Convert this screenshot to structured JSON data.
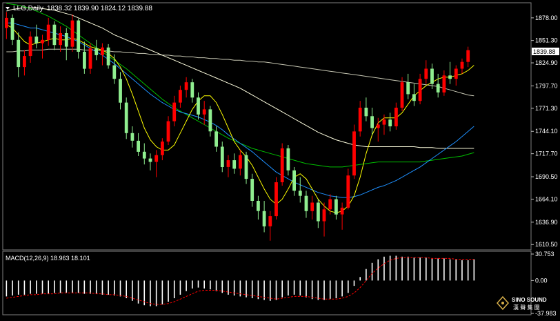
{
  "header": {
    "symbol": "LLG,Daily",
    "ohlc": "1838.32 1839.90 1824.12 1839.88"
  },
  "price_panel": {
    "ticks": [
      "1878.00",
      "1851.30",
      "1824.90",
      "1797.70",
      "1771.30",
      "1744.10",
      "1717.70",
      "1690.50",
      "1664.10",
      "1636.90",
      "1610.50"
    ],
    "current_price": "1839.88"
  },
  "macd_panel": {
    "label": "MACD(12,26,9) 18.963 18.101",
    "ticks": [
      "30.753",
      "0.00",
      "-37.983"
    ]
  },
  "watermark": {
    "brand": "SINO SOUND",
    "sub": "漢 聲 集 團"
  },
  "colors": {
    "background": "#000000",
    "bull_candle": "#ff0000",
    "bear_candle": "#90ee90",
    "ma_fast": "#ffff00",
    "ma_mid": "#1e90ff",
    "ma_slow": "#00c000",
    "ma_long": "#ffffe0",
    "ma_longest": "#c8c8b4",
    "macd_hist": "#ffffff",
    "macd_signal": "#ff0000"
  },
  "chart_data": {
    "type": "candlestick",
    "ylim": [
      1605,
      1895
    ],
    "candles": [
      {
        "o": 1866,
        "h": 1885,
        "l": 1853,
        "c": 1878
      },
      {
        "o": 1878,
        "h": 1882,
        "l": 1846,
        "c": 1852
      },
      {
        "o": 1852,
        "h": 1861,
        "l": 1808,
        "c": 1820
      },
      {
        "o": 1820,
        "h": 1840,
        "l": 1810,
        "c": 1833
      },
      {
        "o": 1833,
        "h": 1862,
        "l": 1825,
        "c": 1856
      },
      {
        "o": 1856,
        "h": 1870,
        "l": 1842,
        "c": 1848
      },
      {
        "o": 1848,
        "h": 1858,
        "l": 1830,
        "c": 1852
      },
      {
        "o": 1852,
        "h": 1878,
        "l": 1845,
        "c": 1870
      },
      {
        "o": 1870,
        "h": 1874,
        "l": 1840,
        "c": 1846
      },
      {
        "o": 1846,
        "h": 1868,
        "l": 1838,
        "c": 1860
      },
      {
        "o": 1860,
        "h": 1866,
        "l": 1828,
        "c": 1844
      },
      {
        "o": 1844,
        "h": 1882,
        "l": 1838,
        "c": 1875
      },
      {
        "o": 1875,
        "h": 1877,
        "l": 1830,
        "c": 1838
      },
      {
        "o": 1838,
        "h": 1850,
        "l": 1812,
        "c": 1818
      },
      {
        "o": 1818,
        "h": 1848,
        "l": 1812,
        "c": 1842
      },
      {
        "o": 1842,
        "h": 1852,
        "l": 1828,
        "c": 1834
      },
      {
        "o": 1834,
        "h": 1848,
        "l": 1822,
        "c": 1843
      },
      {
        "o": 1843,
        "h": 1847,
        "l": 1818,
        "c": 1822
      },
      {
        "o": 1822,
        "h": 1835,
        "l": 1800,
        "c": 1806
      },
      {
        "o": 1806,
        "h": 1814,
        "l": 1770,
        "c": 1778
      },
      {
        "o": 1778,
        "h": 1784,
        "l": 1735,
        "c": 1742
      },
      {
        "o": 1742,
        "h": 1750,
        "l": 1725,
        "c": 1733
      },
      {
        "o": 1733,
        "h": 1742,
        "l": 1715,
        "c": 1720
      },
      {
        "o": 1720,
        "h": 1730,
        "l": 1705,
        "c": 1712
      },
      {
        "o": 1712,
        "h": 1718,
        "l": 1698,
        "c": 1708
      },
      {
        "o": 1708,
        "h": 1722,
        "l": 1690,
        "c": 1716
      },
      {
        "o": 1716,
        "h": 1736,
        "l": 1710,
        "c": 1732
      },
      {
        "o": 1732,
        "h": 1762,
        "l": 1728,
        "c": 1756
      },
      {
        "o": 1756,
        "h": 1786,
        "l": 1750,
        "c": 1778
      },
      {
        "o": 1778,
        "h": 1798,
        "l": 1772,
        "c": 1793
      },
      {
        "o": 1793,
        "h": 1808,
        "l": 1784,
        "c": 1802
      },
      {
        "o": 1802,
        "h": 1806,
        "l": 1778,
        "c": 1784
      },
      {
        "o": 1784,
        "h": 1790,
        "l": 1758,
        "c": 1764
      },
      {
        "o": 1764,
        "h": 1780,
        "l": 1752,
        "c": 1770
      },
      {
        "o": 1770,
        "h": 1774,
        "l": 1738,
        "c": 1744
      },
      {
        "o": 1744,
        "h": 1750,
        "l": 1720,
        "c": 1726
      },
      {
        "o": 1726,
        "h": 1732,
        "l": 1696,
        "c": 1702
      },
      {
        "o": 1702,
        "h": 1716,
        "l": 1690,
        "c": 1710
      },
      {
        "o": 1710,
        "h": 1718,
        "l": 1694,
        "c": 1700
      },
      {
        "o": 1700,
        "h": 1722,
        "l": 1692,
        "c": 1716
      },
      {
        "o": 1716,
        "h": 1720,
        "l": 1682,
        "c": 1688
      },
      {
        "o": 1688,
        "h": 1694,
        "l": 1655,
        "c": 1662
      },
      {
        "o": 1662,
        "h": 1668,
        "l": 1640,
        "c": 1650
      },
      {
        "o": 1650,
        "h": 1662,
        "l": 1625,
        "c": 1632
      },
      {
        "o": 1632,
        "h": 1650,
        "l": 1615,
        "c": 1644
      },
      {
        "o": 1644,
        "h": 1690,
        "l": 1640,
        "c": 1684
      },
      {
        "o": 1684,
        "h": 1730,
        "l": 1680,
        "c": 1724
      },
      {
        "o": 1724,
        "h": 1728,
        "l": 1692,
        "c": 1698
      },
      {
        "o": 1698,
        "h": 1702,
        "l": 1668,
        "c": 1674
      },
      {
        "o": 1674,
        "h": 1690,
        "l": 1660,
        "c": 1668
      },
      {
        "o": 1668,
        "h": 1674,
        "l": 1642,
        "c": 1650
      },
      {
        "o": 1650,
        "h": 1668,
        "l": 1640,
        "c": 1660
      },
      {
        "o": 1660,
        "h": 1664,
        "l": 1630,
        "c": 1638
      },
      {
        "o": 1638,
        "h": 1660,
        "l": 1620,
        "c": 1652
      },
      {
        "o": 1652,
        "h": 1670,
        "l": 1646,
        "c": 1664
      },
      {
        "o": 1664,
        "h": 1668,
        "l": 1640,
        "c": 1646
      },
      {
        "o": 1646,
        "h": 1660,
        "l": 1628,
        "c": 1654
      },
      {
        "o": 1654,
        "h": 1700,
        "l": 1652,
        "c": 1692
      },
      {
        "o": 1692,
        "h": 1752,
        "l": 1688,
        "c": 1744
      },
      {
        "o": 1744,
        "h": 1780,
        "l": 1738,
        "c": 1772
      },
      {
        "o": 1772,
        "h": 1784,
        "l": 1756,
        "c": 1762
      },
      {
        "o": 1762,
        "h": 1772,
        "l": 1740,
        "c": 1748
      },
      {
        "o": 1748,
        "h": 1760,
        "l": 1732,
        "c": 1752
      },
      {
        "o": 1752,
        "h": 1764,
        "l": 1740,
        "c": 1758
      },
      {
        "o": 1758,
        "h": 1766,
        "l": 1744,
        "c": 1750
      },
      {
        "o": 1750,
        "h": 1778,
        "l": 1746,
        "c": 1772
      },
      {
        "o": 1772,
        "h": 1808,
        "l": 1768,
        "c": 1802
      },
      {
        "o": 1802,
        "h": 1812,
        "l": 1782,
        "c": 1788
      },
      {
        "o": 1788,
        "h": 1800,
        "l": 1774,
        "c": 1780
      },
      {
        "o": 1780,
        "h": 1812,
        "l": 1776,
        "c": 1806
      },
      {
        "o": 1806,
        "h": 1828,
        "l": 1800,
        "c": 1818
      },
      {
        "o": 1818,
        "h": 1824,
        "l": 1794,
        "c": 1800
      },
      {
        "o": 1800,
        "h": 1812,
        "l": 1784,
        "c": 1790
      },
      {
        "o": 1790,
        "h": 1816,
        "l": 1786,
        "c": 1810
      },
      {
        "o": 1810,
        "h": 1826,
        "l": 1800,
        "c": 1806
      },
      {
        "o": 1806,
        "h": 1822,
        "l": 1798,
        "c": 1818
      },
      {
        "o": 1818,
        "h": 1830,
        "l": 1812,
        "c": 1826
      },
      {
        "o": 1826,
        "h": 1844,
        "l": 1820,
        "c": 1839.88
      }
    ],
    "ma_fast": [
      1870,
      1866,
      1858,
      1850,
      1846,
      1848,
      1850,
      1852,
      1854,
      1852,
      1852,
      1854,
      1852,
      1848,
      1844,
      1842,
      1840,
      1836,
      1830,
      1820,
      1806,
      1788,
      1768,
      1748,
      1734,
      1726,
      1722,
      1722,
      1728,
      1742,
      1756,
      1770,
      1780,
      1786,
      1786,
      1778,
      1764,
      1748,
      1732,
      1722,
      1714,
      1704,
      1690,
      1676,
      1664,
      1658,
      1664,
      1676,
      1690,
      1694,
      1688,
      1676,
      1664,
      1656,
      1650,
      1648,
      1650,
      1656,
      1668,
      1690,
      1718,
      1740,
      1754,
      1760,
      1760,
      1760,
      1766,
      1776,
      1786,
      1792,
      1798,
      1802,
      1806,
      1808,
      1808,
      1810,
      1812,
      1816,
      1822
    ],
    "ma_mid": [
      1872,
      1872,
      1870,
      1868,
      1866,
      1866,
      1864,
      1862,
      1860,
      1858,
      1856,
      1853,
      1850,
      1846,
      1842,
      1838,
      1834,
      1829,
      1824,
      1818,
      1812,
      1806,
      1800,
      1794,
      1788,
      1783,
      1778,
      1774,
      1770,
      1767,
      1765,
      1763,
      1761,
      1758,
      1755,
      1751,
      1746,
      1740,
      1735,
      1730,
      1725,
      1720,
      1714,
      1708,
      1702,
      1696,
      1692,
      1688,
      1684,
      1681,
      1678,
      1675,
      1672,
      1670,
      1668,
      1667,
      1666,
      1666,
      1667,
      1669,
      1672,
      1675,
      1678,
      1680,
      1683,
      1686,
      1690,
      1694,
      1698,
      1702,
      1707,
      1712,
      1717,
      1722,
      1727,
      1732,
      1738,
      1744,
      1750
    ],
    "ma_slow": [
      1895,
      1894,
      1893,
      1891,
      1889,
      1886,
      1883,
      1880,
      1876,
      1872,
      1868,
      1863,
      1858,
      1853,
      1848,
      1843,
      1838,
      1833,
      1828,
      1823,
      1818,
      1812,
      1806,
      1800,
      1794,
      1788,
      1782,
      1777,
      1772,
      1768,
      1764,
      1760,
      1756,
      1752,
      1748,
      1744,
      1740,
      1736,
      1733,
      1730,
      1727,
      1724,
      1722,
      1720,
      1718,
      1716,
      1714,
      1712,
      1710,
      1708,
      1706,
      1705,
      1704,
      1703,
      1702,
      1702,
      1702,
      1703,
      1704,
      1705,
      1706,
      1707,
      1708,
      1708,
      1708,
      1708,
      1708,
      1708,
      1708,
      1708,
      1709,
      1710,
      1711,
      1712,
      1713,
      1714,
      1715,
      1717,
      1719
    ],
    "ma_long": [
      1886,
      1888,
      1889,
      1890,
      1890,
      1890,
      1889,
      1888,
      1887,
      1885,
      1883,
      1881,
      1878,
      1875,
      1872,
      1869,
      1866,
      1862,
      1858,
      1855,
      1852,
      1849,
      1846,
      1843,
      1840,
      1837,
      1834,
      1831,
      1828,
      1825,
      1822,
      1819,
      1816,
      1813,
      1810,
      1807,
      1804,
      1801,
      1798,
      1795,
      1791,
      1787,
      1783,
      1779,
      1775,
      1771,
      1767,
      1763,
      1759,
      1755,
      1751,
      1747,
      1743,
      1740,
      1737,
      1734,
      1732,
      1730,
      1728,
      1727,
      1726,
      1726,
      1726,
      1726,
      1726,
      1726,
      1726,
      1726,
      1726,
      1725,
      1725,
      1725,
      1724,
      1724,
      1724,
      1724,
      1724,
      1724,
      1724
    ],
    "ma_longest": [
      1838,
      1838,
      1839,
      1839,
      1840,
      1840,
      1840,
      1841,
      1841,
      1841,
      1841,
      1841,
      1841,
      1840,
      1840,
      1840,
      1839,
      1839,
      1838,
      1838,
      1837,
      1837,
      1836,
      1836,
      1835,
      1835,
      1834,
      1834,
      1833,
      1833,
      1832,
      1832,
      1831,
      1831,
      1830,
      1830,
      1829,
      1829,
      1828,
      1828,
      1827,
      1827,
      1826,
      1826,
      1825,
      1824,
      1823,
      1822,
      1821,
      1820,
      1819,
      1818,
      1817,
      1816,
      1815,
      1814,
      1813,
      1812,
      1811,
      1810,
      1809,
      1808,
      1807,
      1806,
      1805,
      1804,
      1803,
      1802,
      1801,
      1800,
      1799,
      1798,
      1797,
      1795,
      1793,
      1791,
      1789,
      1787,
      1786
    ],
    "macd": {
      "ylim": [
        -37.983,
        30.753
      ],
      "histogram": [
        -18,
        -17,
        -16,
        -16,
        -15,
        -15,
        -15,
        -15,
        -14,
        -14,
        -14,
        -14,
        -14,
        -15,
        -15,
        -15,
        -16,
        -16,
        -17,
        -18,
        -20,
        -23,
        -26,
        -28,
        -29,
        -29,
        -27,
        -24,
        -20,
        -16,
        -12,
        -9,
        -8,
        -9,
        -10,
        -12,
        -14,
        -16,
        -17,
        -18,
        -19,
        -20,
        -21,
        -22,
        -23,
        -22,
        -19,
        -17,
        -16,
        -17,
        -19,
        -21,
        -22,
        -22,
        -21,
        -20,
        -18,
        -14,
        -6,
        4,
        13,
        20,
        24,
        27,
        28,
        28,
        27,
        27,
        26,
        26,
        26,
        25,
        25,
        25,
        24,
        24,
        23,
        23,
        24
      ],
      "signal": [
        -20,
        -19,
        -18,
        -17,
        -16,
        -16,
        -15,
        -15,
        -15,
        -14,
        -14,
        -14,
        -14,
        -14,
        -14,
        -15,
        -15,
        -16,
        -16,
        -17,
        -18,
        -20,
        -22,
        -24,
        -26,
        -27,
        -27,
        -26,
        -24,
        -21,
        -18,
        -15,
        -12,
        -11,
        -11,
        -11,
        -12,
        -13,
        -14,
        -15,
        -16,
        -17,
        -18,
        -19,
        -20,
        -21,
        -20,
        -19,
        -18,
        -18,
        -18,
        -19,
        -20,
        -21,
        -21,
        -21,
        -20,
        -18,
        -14,
        -8,
        0,
        8,
        14,
        19,
        23,
        25,
        26,
        26,
        26,
        26,
        26,
        25,
        25,
        25,
        25,
        24,
        24,
        24,
        24
      ]
    }
  }
}
